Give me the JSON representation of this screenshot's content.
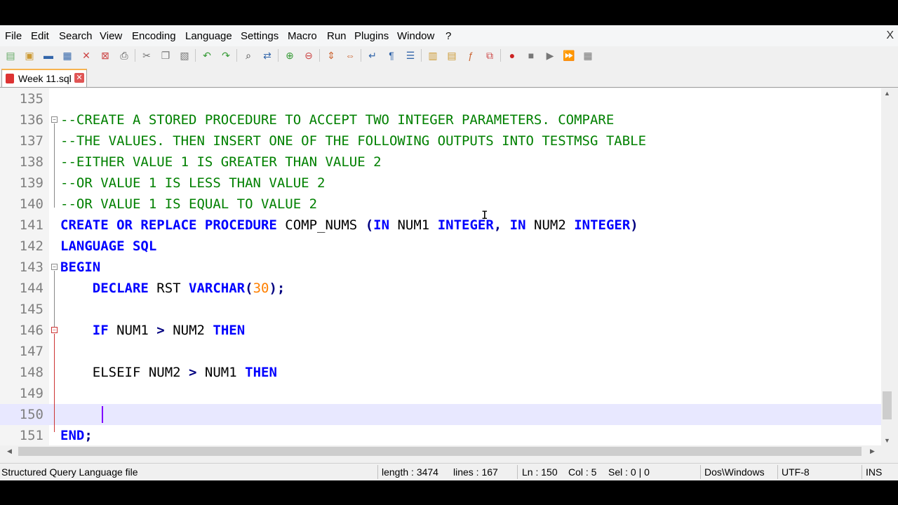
{
  "menu": {
    "items": [
      "File",
      "Edit",
      "Search",
      "View",
      "Encoding",
      "Language",
      "Settings",
      "Macro",
      "Run",
      "Plugins",
      "Window",
      "?"
    ],
    "close": "X"
  },
  "toolbar": {
    "icons": [
      "new-file-icon",
      "open-file-icon",
      "save-icon",
      "save-all-icon",
      "close-icon",
      "close-all-icon",
      "print-icon",
      "cut-icon",
      "copy-icon",
      "paste-icon",
      "undo-icon",
      "redo-icon",
      "find-icon",
      "replace-icon",
      "zoom-in-icon",
      "zoom-out-icon",
      "sync-v-icon",
      "sync-h-icon",
      "word-wrap-icon",
      "show-all-chars-icon",
      "indent-guide-icon",
      "folder-as-workspace-icon",
      "doc-map-icon",
      "function-list-icon",
      "doc-switcher-icon",
      "record-macro-icon",
      "stop-macro-icon",
      "play-macro-icon",
      "run-macro-multiple-icon",
      "save-macro-icon"
    ]
  },
  "tab": {
    "label": "Week 11.sql",
    "close": "✕"
  },
  "editor": {
    "lines": [
      {
        "n": "135",
        "segs": []
      },
      {
        "n": "136",
        "segs": [
          [
            "cmt",
            "--CREATE A STORED PROCEDURE TO ACCEPT TWO INTEGER PARAMETERS. COMPARE"
          ]
        ]
      },
      {
        "n": "137",
        "segs": [
          [
            "cmt",
            "--THE VALUES. THEN INSERT ONE OF THE FOLLOWING OUTPUTS INTO TESTMSG TABLE"
          ]
        ]
      },
      {
        "n": "138",
        "segs": [
          [
            "cmt",
            "--EITHER VALUE 1 IS GREATER THAN VALUE 2"
          ]
        ]
      },
      {
        "n": "139",
        "segs": [
          [
            "cmt",
            "--OR VALUE 1 IS LESS THAN VALUE 2"
          ]
        ]
      },
      {
        "n": "140",
        "segs": [
          [
            "cmt",
            "--OR VALUE 1 IS EQUAL TO VALUE 2"
          ]
        ]
      },
      {
        "n": "141",
        "segs": [
          [
            "kw",
            "CREATE OR REPLACE PROCEDURE"
          ],
          [
            "txt",
            " COMP_NUMS "
          ],
          [
            "op",
            "("
          ],
          [
            "kw",
            "IN"
          ],
          [
            "txt",
            " NUM1 "
          ],
          [
            "kw",
            "INTEGER"
          ],
          [
            "op",
            ","
          ],
          [
            "txt",
            " "
          ],
          [
            "kw",
            "IN"
          ],
          [
            "txt",
            " NUM2 "
          ],
          [
            "kw",
            "INTEGER"
          ],
          [
            "op",
            ")"
          ]
        ]
      },
      {
        "n": "142",
        "segs": [
          [
            "kw",
            "LANGUAGE SQL"
          ]
        ]
      },
      {
        "n": "143",
        "segs": [
          [
            "kw",
            "BEGIN"
          ]
        ]
      },
      {
        "n": "144",
        "segs": [
          [
            "txt",
            "    "
          ],
          [
            "kw",
            "DECLARE"
          ],
          [
            "txt",
            " RST "
          ],
          [
            "kw",
            "VARCHAR"
          ],
          [
            "op",
            "("
          ],
          [
            "num",
            "30"
          ],
          [
            "op",
            ");"
          ]
        ]
      },
      {
        "n": "145",
        "segs": []
      },
      {
        "n": "146",
        "segs": [
          [
            "txt",
            "    "
          ],
          [
            "kw",
            "IF"
          ],
          [
            "txt",
            " NUM1 "
          ],
          [
            "op",
            ">"
          ],
          [
            "txt",
            " NUM2 "
          ],
          [
            "kw",
            "THEN"
          ]
        ]
      },
      {
        "n": "147",
        "segs": []
      },
      {
        "n": "148",
        "segs": [
          [
            "txt",
            "    ELSEIF NUM2 "
          ],
          [
            "op",
            ">"
          ],
          [
            "txt",
            " NUM1 "
          ],
          [
            "kw",
            "THEN"
          ]
        ]
      },
      {
        "n": "149",
        "segs": []
      },
      {
        "n": "150",
        "segs": [],
        "current": true
      },
      {
        "n": "151",
        "segs": [
          [
            "kw",
            "END"
          ],
          [
            "op",
            ";"
          ]
        ]
      }
    ]
  },
  "status": {
    "filetype": "Structured Query Language file",
    "length": "length : 3474",
    "lines": "lines : 167",
    "ln": "Ln : 150",
    "col": "Col : 5",
    "sel": "Sel : 0 | 0",
    "eol": "Dos\\Windows",
    "encoding": "UTF-8",
    "mode": "INS"
  }
}
